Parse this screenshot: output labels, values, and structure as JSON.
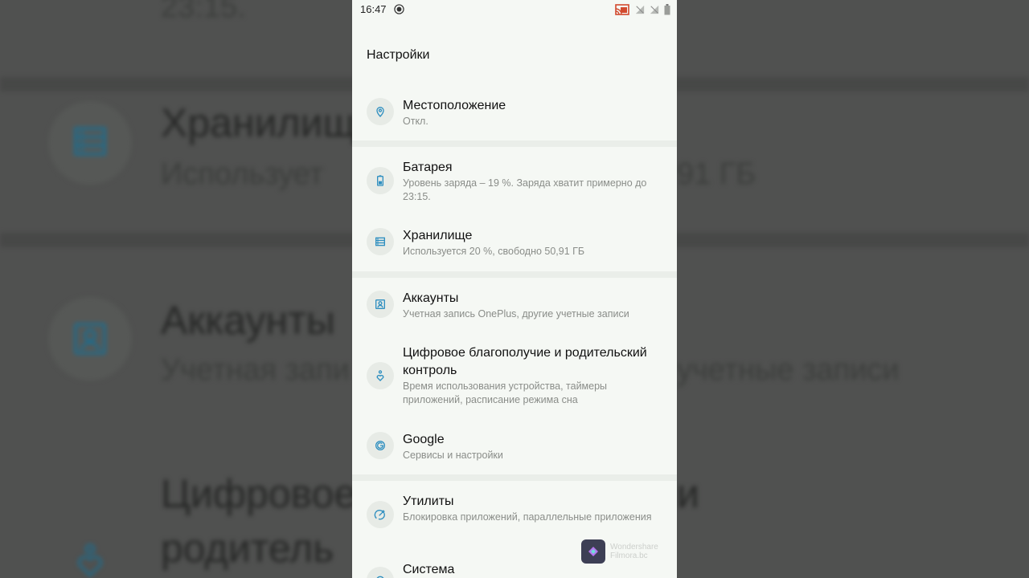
{
  "status_bar": {
    "time": "16:47"
  },
  "screen_title": "Настройки",
  "settings": [
    {
      "title": "Местоположение",
      "subtitle": "Откл.",
      "icon": "location-icon"
    },
    {
      "title": "Батарея",
      "subtitle": "Уровень заряда – 19 %. Заряда хватит примерно до 23:15.",
      "icon": "battery-icon"
    },
    {
      "title": "Хранилище",
      "subtitle": "Используется 20 %, свободно 50,91 ГБ",
      "icon": "storage-icon"
    },
    {
      "title": "Аккаунты",
      "subtitle": "Учетная запись OnePlus, другие учетные записи",
      "icon": "account-icon"
    },
    {
      "title": "Цифровое благополучие и родительский контроль",
      "subtitle": "Время использования устройства, таймеры приложений, расписание режима сна",
      "icon": "wellbeing-icon"
    },
    {
      "title": "Google",
      "subtitle": "Сервисы и настройки",
      "icon": "google-icon"
    },
    {
      "title": "Утилиты",
      "subtitle": "Блокировка приложений, параллельные приложения",
      "icon": "utilities-icon"
    },
    {
      "title": "Система",
      "subtitle": "",
      "icon": "system-icon"
    }
  ],
  "background": {
    "line1": "23:15.",
    "storage_title": "Хранилищ",
    "storage_sub": "Использует",
    "storage_sub_end": "91 ГБ",
    "accounts_title": "Аккаунты",
    "accounts_sub": "Учетная запи",
    "accounts_sub_end": "учетные записи",
    "wellbeing_title": "Цифровое",
    "wellbeing_title_end": "и",
    "wellbeing_title2": "родитель"
  },
  "watermark": {
    "line1": "Wondershare",
    "line2": "Filmora.bc"
  },
  "colors": {
    "accent": "#2f8fc0",
    "panel": "#f5f8f4",
    "divider": "#eaeee9"
  }
}
